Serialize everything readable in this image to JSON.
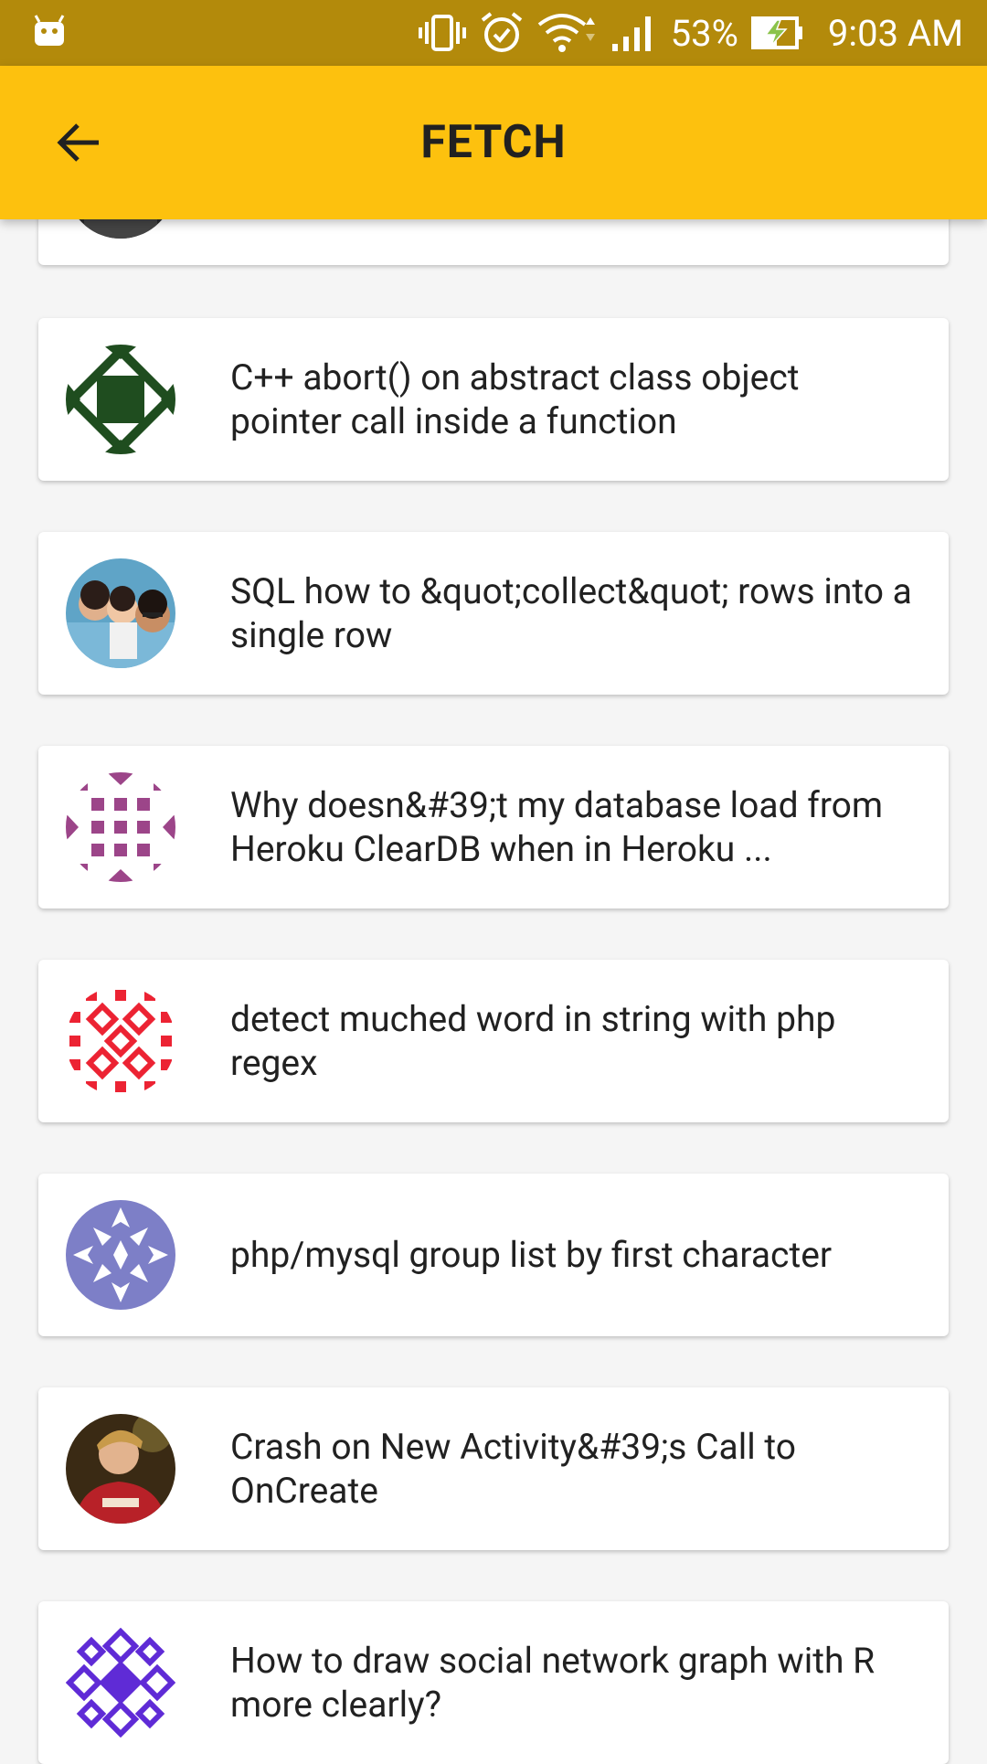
{
  "status_bar": {
    "battery": "53%",
    "time": "9:03 AM",
    "icons": [
      "android-icon",
      "vibrate-icon",
      "alarm-icon",
      "wifi-icon",
      "signal-icon",
      "battery-charging-icon"
    ]
  },
  "app_bar": {
    "title": "FETCH",
    "back_icon": "arrow-left-icon"
  },
  "questions": [
    {
      "title": "",
      "avatar": "photo-avatar-dark"
    },
    {
      "title": "C++ abort() on abstract class object pointer call inside a function",
      "avatar": "identicon-green"
    },
    {
      "title": "SQL how to &quot;collect&quot; rows into a single row",
      "avatar": "photo-avatar-family"
    },
    {
      "title": "Why doesn&#39;t my database load from Heroku ClearDB when in Heroku ...",
      "avatar": "identicon-magenta"
    },
    {
      "title": "detect muched word in string with php regex",
      "avatar": "identicon-red"
    },
    {
      "title": "php/mysql group list by first character",
      "avatar": "identicon-lavender"
    },
    {
      "title": "Crash on New Activity&#39;s Call to OnCreate",
      "avatar": "photo-avatar-red-hoodie"
    },
    {
      "title": "How to draw social network graph with R more clearly?",
      "avatar": "identicon-purple"
    }
  ],
  "colors": {
    "status_bar": "#b38a0b",
    "app_bar": "#fdc10e",
    "background": "#f5f5f5",
    "card": "#ffffff",
    "text": "#212121"
  }
}
